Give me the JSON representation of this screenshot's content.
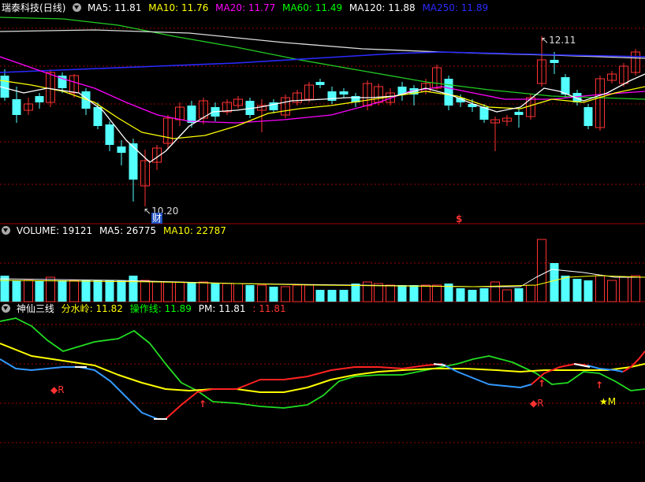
{
  "main": {
    "stock_name": "瑞泰科技",
    "period": "(日线)",
    "ma_labels": [
      {
        "text": "MA5: 11.81",
        "color": "#ffffff"
      },
      {
        "text": "MA10: 11.76",
        "color": "#ffff00"
      },
      {
        "text": "MA20: 11.77",
        "color": "#ff00ff"
      },
      {
        "text": "MA60: 11.49",
        "color": "#00ff00"
      },
      {
        "text": "MA120: 11.88",
        "color": "#ffffff"
      },
      {
        "text": "MA250: 11.89",
        "color": "#2020ff"
      }
    ],
    "high_label": "12.11",
    "low_label": "10.20",
    "marker_cai": "财",
    "marker_dollar": "$"
  },
  "volume": {
    "title": "VOLUME: 19121",
    "ma5": "MA5: 26775",
    "ma10": "MA10: 22787"
  },
  "indicator": {
    "name": "神仙三线",
    "fsl": "分水岭: 11.82",
    "czx": "操作线: 11.89",
    "pm": "PM: 11.81",
    "extra": ": 11.81",
    "signal_r": "R",
    "signal_m": "M"
  },
  "colors": {
    "up": "#ff3232",
    "down": "#54ffff",
    "grid": "#a00000",
    "bg": "#000000"
  }
}
